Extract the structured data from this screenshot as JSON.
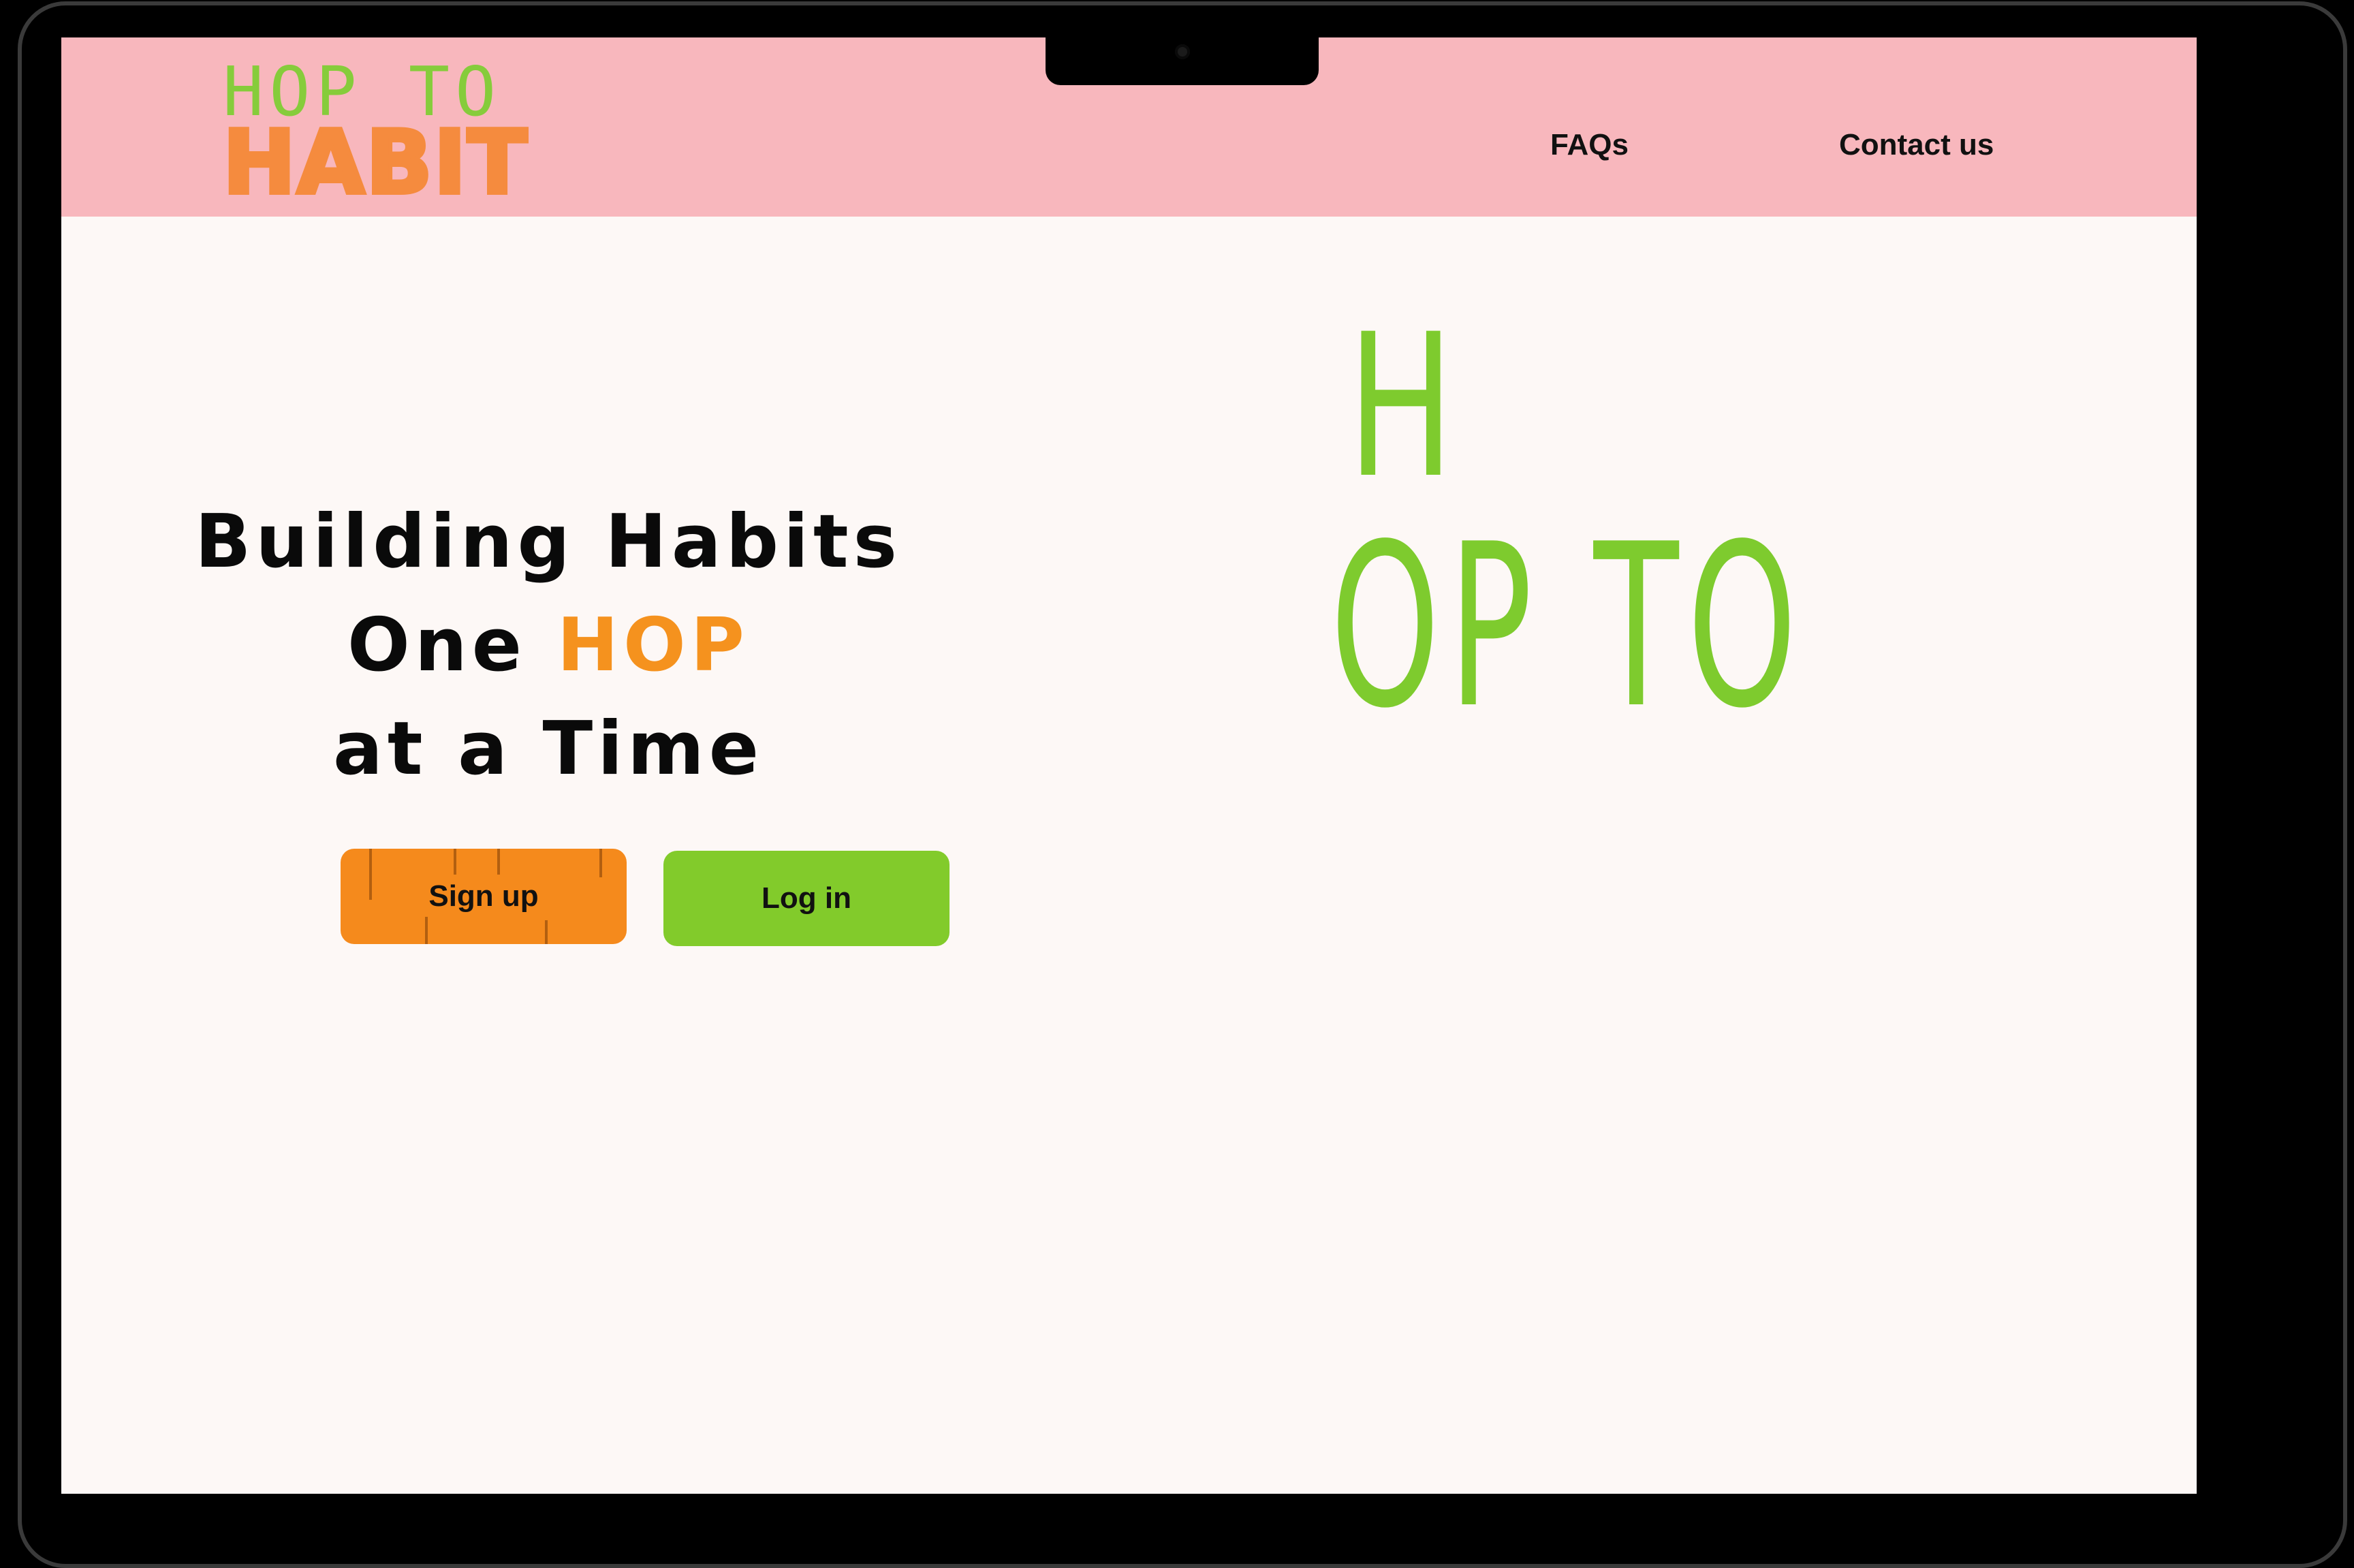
{
  "logo": {
    "line1": "HOP TO",
    "line2": "HABIT"
  },
  "nav": {
    "faqs": "FAQs",
    "contact": "Contact us"
  },
  "hero": {
    "line1": "Building Habits",
    "line2_prefix": "One ",
    "line2_accent": "HOP",
    "line3": "at a Time"
  },
  "buttons": {
    "signup": "Sign up",
    "login": "Log in"
  },
  "animated_title": {
    "first": "H",
    "rest": "OP TO"
  },
  "colors": {
    "header": "#f8b7bd",
    "background": "#fdf8f6",
    "green": "#82cb2b",
    "orange": "#f58a1c"
  }
}
